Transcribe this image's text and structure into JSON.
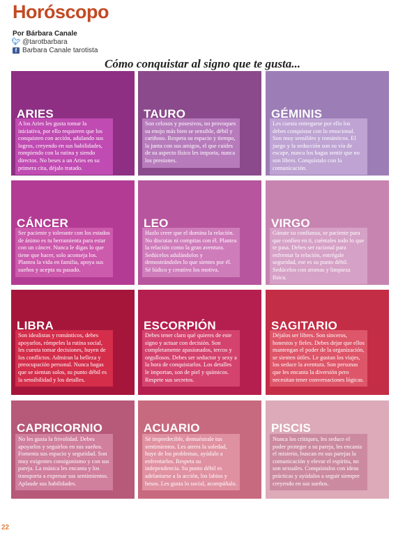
{
  "header": {
    "title": "Horóscopo",
    "byline": "Por Bárbara Canale",
    "twitter_icon": "twitter-bird-icon",
    "twitter": "@tarotbarbara",
    "facebook_icon": "facebook-icon",
    "facebook": "Barbara Canale tarotista"
  },
  "subtitle": "Cómo conquistar al signo que te gusta...",
  "signs": [
    {
      "name": "ARIES",
      "panel_color": "#8e2f83",
      "box_color": "#c04bb2",
      "text": "A los Aries les gusta tomar la iniciativa, por ello requieren que los conquisten con acción, adulando sus logros, creyendo en sus habilidades, rompiendo con la rutina y siendo directos. No beses a un Aries en su primera cita, déjalo tratado."
    },
    {
      "name": "TAURO",
      "panel_color": "#8b4a8c",
      "box_color": "#b77bbc",
      "text": "Son celosos y posesivos, no provoques su enojo más bien se sensible, débil y cariñoso. Respeta su espacio y tiempo, la junta con sus amigos, el que cuides de su aspecto físico les importa, nunca los presiones."
    },
    {
      "name": "GÉMINIS",
      "panel_color": "#9c7db6",
      "box_color": "#bea3d3",
      "text": "Les cuesta entregarse por ello los debes conquistar con lo emocional. Son muy sensibles y románticos. El juego y la seducción son su vía de escape, nunca los hagas sentir que no son libres. Conquístalo con la comunicación."
    },
    {
      "name": "CÁNCER",
      "panel_color": "#b43b93",
      "box_color": "#cc5aad",
      "text": "Ser paciente y tolerante con los estados de ánimo es tu herramienta para estar con un cáncer. Nunca le digas lo que tiene que hacer, solo aconseja los. Plantea la vida en familia, apoya sus sueños y acepta su pasado."
    },
    {
      "name": "LEO",
      "panel_color": "#b7559e",
      "box_color": "#cf7cbb",
      "text": "Hazlo creer que el domina la relación. No discutas ni compitas con él. Plantea la relación como la gran aventura. Sedúcelos adulándolos y demostrándoles lo que sientes por él. Sé lúdico y creativo los motiva."
    },
    {
      "name": "VIRGO",
      "panel_color": "#c784b0",
      "box_color": "#d6a1c6",
      "text": "Gánate su confianza, se paciente para que confíen en ti, cuéntales todo lo que te pasa. Debes ser racional para enfrentar la relación, entrégale seguridad, ese es su punto débil. Sedúcelos con aromas y limpieza física."
    },
    {
      "name": "LIBRA",
      "panel_color": "#a5163a",
      "box_color": "#d42e4b",
      "text": "Son idealistas y románticos, debes apoyarlos, rómpeles la rutina social, les cuesta tomar decisiones, huyen de los conflictos. Admiran la belleza y preocupación personal. Nunca hagas que se sientan solos, su punto débil es la sensibilidad y los detalles."
    },
    {
      "name": "ESCORPIÓN",
      "panel_color": "#b51f4f",
      "box_color": "#d4436e",
      "text": "Debes tener claro qué quieres de este signo y actuar con decisión. Son completamente apasionados, tercos y orgullosos. Debes ser seductor y sexy a la hora de conquistarlos. Los detalles le importan, son de piel y químicos. Respete sus secretos."
    },
    {
      "name": "SAGITARIO",
      "panel_color": "#c32d45",
      "box_color": "#de5669",
      "text": "Déjalos ser libres. Son sinceros, honestos y fieles. Debes dejar que ellos mantengan el poder de la organización, se sienten útiles. Le gustan los viajes, los seduce la aventura. Son personas que les encanta la diversión pero necesitan tener conversaciones lógicas."
    },
    {
      "name": "CAPRICORNIO",
      "panel_color": "#b75979",
      "box_color": "#d07f9d",
      "text": "No les gusta la frivolidad. Debes apoyarlos y seguirlos en sus sueños. Fomenta sus espacio y seguridad. Son muy exigentes consigonismo y con sus pareja. La música les encanta y los transporta a expresar sus sentimientos. Aplaude sus habilidades."
    },
    {
      "name": "ACUARIO",
      "panel_color": "#c86a7f",
      "box_color": "#e091a1",
      "text": "Sé impredecible, demuéstrale tus sentimientos. Les aterra la soledad, huye de los problemas, ayúdalo a enfrentarlos. Respeta su independencia. Su punto débil es adelantarse a la acción, los labios y besos. Les gusta lo social, acompáñalo."
    },
    {
      "name": "PISCIS",
      "panel_color": "#dcaab9",
      "box_color": "#cc8aa0",
      "text": "Nunca los critiques, les seduce el poder proteger a su pareja, les encanta el misterio, buscan en sus parejas la comunicación y elevar el espíritu, no son sexuales. Conquístalos con ideas prácticas y ayúdalos a seguir siempre creyendo en sus sueños."
    }
  ],
  "page_number": "22"
}
